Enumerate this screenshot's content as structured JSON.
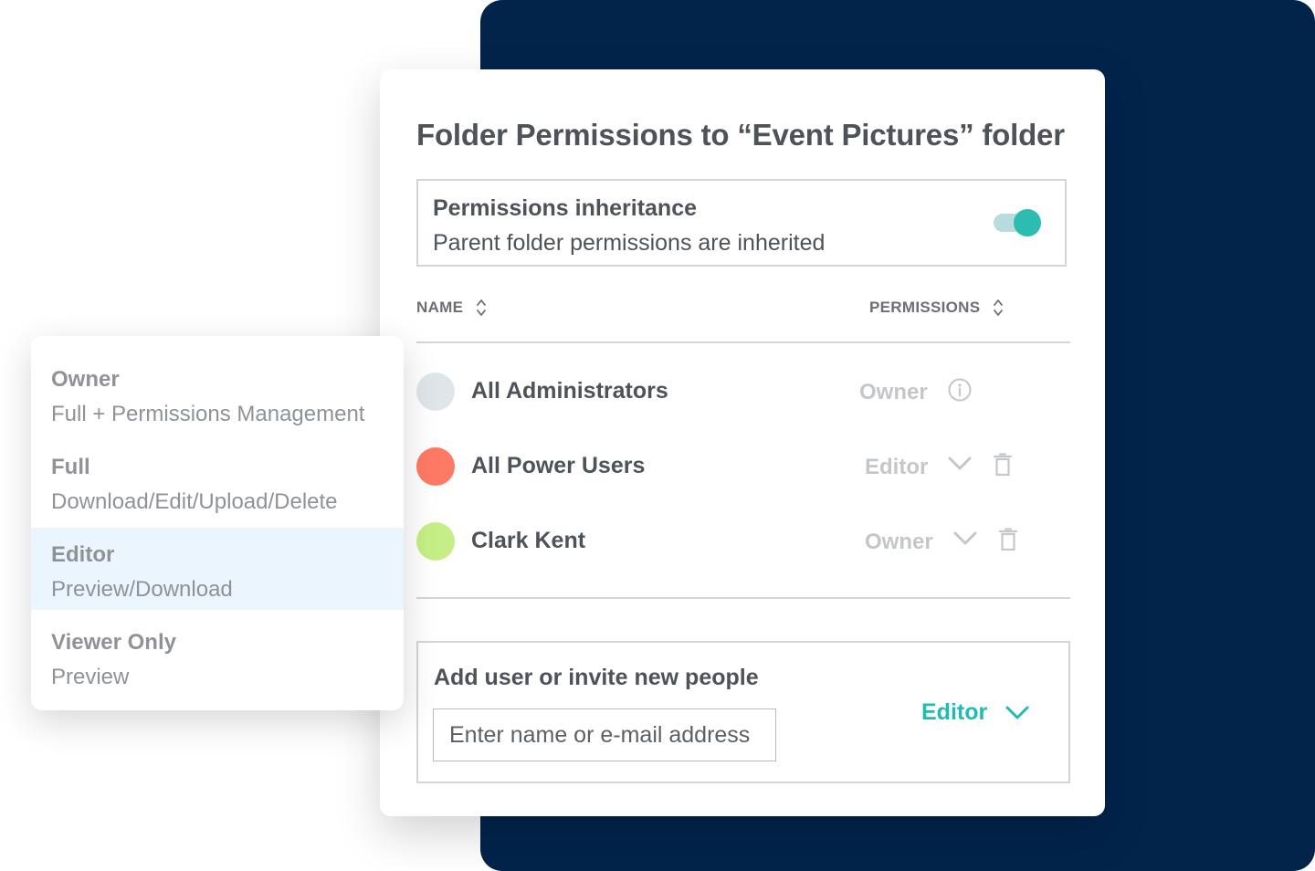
{
  "colors": {
    "navy": "#02244b",
    "teal": "#21bbb1",
    "text_dark": "#4e5259",
    "text_muted": "#c4c7ca",
    "selected_bg": "#eaf5fd"
  },
  "card": {
    "title": "Folder Permissions to “Event Pictures” folder",
    "inheritance": {
      "title": "Permissions inheritance",
      "subtitle": "Parent folder permissions are inherited",
      "toggle_on": true
    },
    "columns": {
      "name": "NAME",
      "permissions": "PERMISSIONS"
    },
    "rows": [
      {
        "name": "All Administrators",
        "permission": "Owner",
        "avatar_color": "#dfe6e9",
        "action_icon": "info-icon"
      },
      {
        "name": "All Power Users",
        "permission": "Editor",
        "avatar_color": "#fe7a64",
        "action_icon": "trash-icon"
      },
      {
        "name": "Clark Kent",
        "permission": "Owner",
        "avatar_color": "#c5ef86",
        "action_icon": "trash-icon"
      }
    ],
    "add_user": {
      "title": "Add user or invite new people",
      "placeholder": "Enter name or e-mail address",
      "role": "Editor"
    }
  },
  "dropdown": {
    "options": [
      {
        "title": "Owner",
        "description": "Full + Permissions Management",
        "selected": false
      },
      {
        "title": "Full",
        "description": "Download/Edit/Upload/Delete",
        "selected": false
      },
      {
        "title": "Editor",
        "description": "Preview/Download",
        "selected": true
      },
      {
        "title": "Viewer Only",
        "description": "Preview",
        "selected": false
      }
    ]
  }
}
